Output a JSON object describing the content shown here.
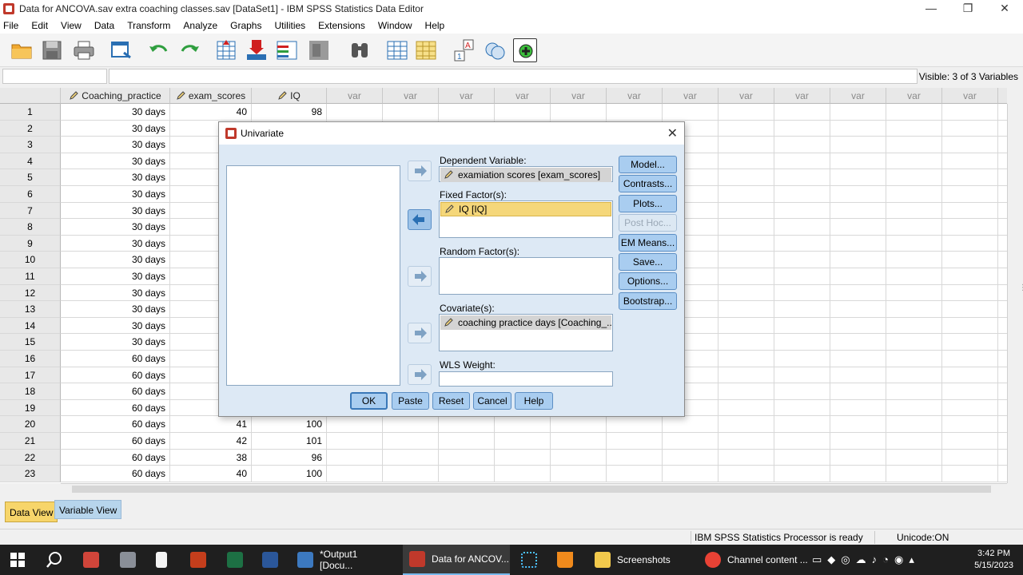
{
  "window": {
    "title": "Data for ANCOVA.sav extra coaching classes.sav [DataSet1] - IBM SPSS Statistics Data Editor",
    "controls": [
      "—",
      "❐",
      "✕"
    ]
  },
  "menu": [
    "File",
    "Edit",
    "View",
    "Data",
    "Transform",
    "Analyze",
    "Graphs",
    "Utilities",
    "Extensions",
    "Window",
    "Help"
  ],
  "toolbar": {
    "icons": [
      "open-icon",
      "save-icon",
      "print-icon",
      "dialog-recall-icon",
      "undo-icon",
      "redo-icon",
      "goto-case-icon",
      "goto-variable-icon",
      "variables-icon",
      "find-icon",
      "insert-cases-icon",
      "insert-variable-icon",
      "split-file-icon",
      "weight-cases-icon",
      "select-cases-icon",
      "value-labels-icon",
      "use-sets-icon",
      "spelling-icon"
    ]
  },
  "cellbar": {
    "reference": "",
    "value": "",
    "visible": "Visible: 3 of 3 Variables"
  },
  "grid": {
    "columns": [
      "Coaching_practice",
      "exam_scores",
      "IQ",
      "var",
      "var",
      "var",
      "var",
      "var",
      "var",
      "var",
      "var",
      "var",
      "var",
      "var",
      "var",
      "var"
    ],
    "rows": [
      {
        "n": "1",
        "c": "30 days",
        "e": "40",
        "iq": "98"
      },
      {
        "n": "2",
        "c": "30 days",
        "e": "",
        "iq": ""
      },
      {
        "n": "3",
        "c": "30 days",
        "e": "",
        "iq": ""
      },
      {
        "n": "4",
        "c": "30 days",
        "e": "",
        "iq": ""
      },
      {
        "n": "5",
        "c": "30 days",
        "e": "",
        "iq": ""
      },
      {
        "n": "6",
        "c": "30 days",
        "e": "",
        "iq": ""
      },
      {
        "n": "7",
        "c": "30 days",
        "e": "",
        "iq": ""
      },
      {
        "n": "8",
        "c": "30 days",
        "e": "",
        "iq": ""
      },
      {
        "n": "9",
        "c": "30 days",
        "e": "",
        "iq": ""
      },
      {
        "n": "10",
        "c": "30 days",
        "e": "",
        "iq": ""
      },
      {
        "n": "11",
        "c": "30 days",
        "e": "",
        "iq": ""
      },
      {
        "n": "12",
        "c": "30 days",
        "e": "",
        "iq": ""
      },
      {
        "n": "13",
        "c": "30 days",
        "e": "",
        "iq": ""
      },
      {
        "n": "14",
        "c": "30 days",
        "e": "",
        "iq": ""
      },
      {
        "n": "15",
        "c": "30 days",
        "e": "",
        "iq": ""
      },
      {
        "n": "16",
        "c": "60 days",
        "e": "",
        "iq": ""
      },
      {
        "n": "17",
        "c": "60 days",
        "e": "",
        "iq": ""
      },
      {
        "n": "18",
        "c": "60 days",
        "e": "",
        "iq": ""
      },
      {
        "n": "19",
        "c": "60 days",
        "e": "",
        "iq": ""
      },
      {
        "n": "20",
        "c": "60 days",
        "e": "41",
        "iq": "100"
      },
      {
        "n": "21",
        "c": "60 days",
        "e": "42",
        "iq": "101"
      },
      {
        "n": "22",
        "c": "60 days",
        "e": "38",
        "iq": "96"
      },
      {
        "n": "23",
        "c": "60 days",
        "e": "40",
        "iq": "100"
      }
    ]
  },
  "tabs": {
    "data_view": "Data View",
    "variable_view": "Variable View"
  },
  "status": {
    "processor": "IBM SPSS Statistics Processor is ready",
    "unicode": "Unicode:ON"
  },
  "dialog": {
    "title": "Univariate",
    "dependent_label": "Dependent Variable:",
    "dependent_value": "examiation scores [exam_scores]",
    "fixed_label": "Fixed Factor(s):",
    "fixed_value": "IQ [IQ]",
    "random_label": "Random Factor(s):",
    "covariate_label": "Covariate(s):",
    "covariate_value": "coaching practice days [Coaching_...",
    "wls_label": "WLS Weight:",
    "side_buttons": [
      "Model...",
      "Contrasts...",
      "Plots...",
      "Post Hoc...",
      "EM Means...",
      "Save...",
      "Options...",
      "Bootstrap..."
    ],
    "bottom_buttons": [
      "OK",
      "Paste",
      "Reset",
      "Cancel",
      "Help"
    ]
  },
  "taskbar": {
    "items": [
      "*Output1 [Docu...",
      "Data for ANCOV...",
      "Screenshots",
      "Channel content ..."
    ],
    "time": "3:42 PM",
    "date": "5/15/2023"
  }
}
